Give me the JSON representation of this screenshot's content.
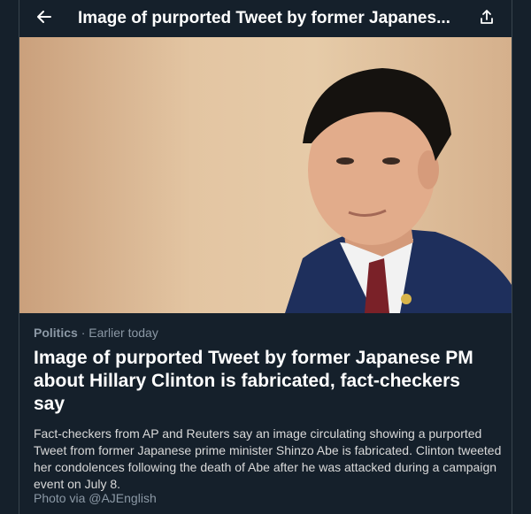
{
  "header": {
    "title": "Image of purported Tweet by former Japanes...",
    "back_icon": "arrow-left-icon",
    "share_icon": "share-icon"
  },
  "article": {
    "category": "Politics",
    "separator": "·",
    "time": "Earlier today",
    "headline": "Image of purported Tweet by former Japanese PM about Hillary Clinton is fabricated, fact-checkers say",
    "summary": "Fact-checkers from AP and Reuters say an image circulating showing a purported Tweet from former Japanese prime minister Shinzo Abe is fabricated. Clinton tweeted her condolences following the death of Abe after he was attacked during a campaign event on July 8.",
    "photo_credit": "Photo via @AJEnglish"
  },
  "colors": {
    "background": "#15202b",
    "text_primary": "#ffffff",
    "text_secondary": "#8b98a5"
  }
}
